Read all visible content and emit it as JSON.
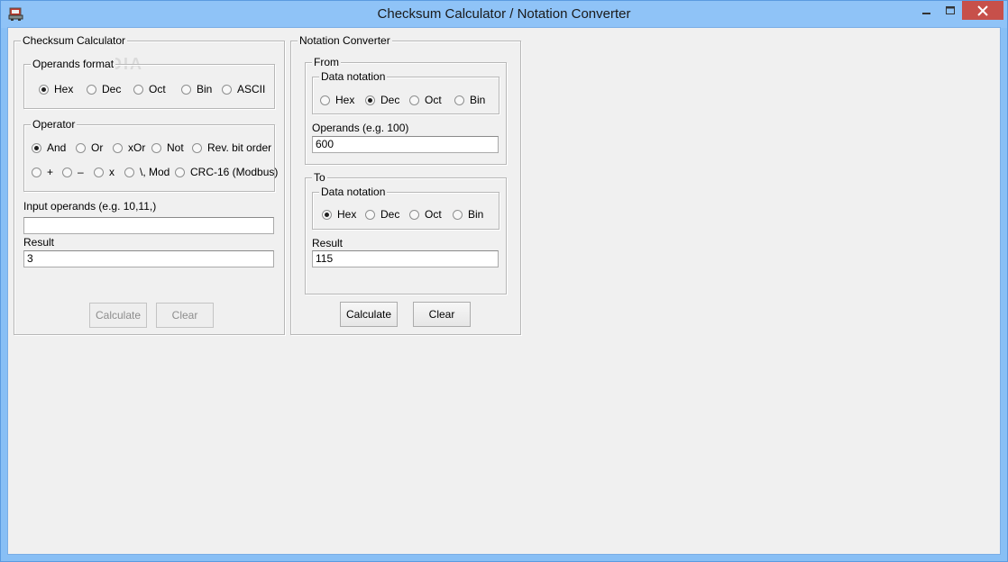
{
  "window": {
    "title": "Checksum Calculator / Notation Converter"
  },
  "checksum": {
    "group_title": "Checksum Calculator",
    "operands_format": {
      "title": "Operands format",
      "options": [
        {
          "label": "Hex",
          "checked": true
        },
        {
          "label": "Dec",
          "checked": false
        },
        {
          "label": "Oct",
          "checked": false
        },
        {
          "label": "Bin",
          "checked": false
        },
        {
          "label": "ASCII",
          "checked": false
        }
      ]
    },
    "operator": {
      "title": "Operator",
      "row1": [
        {
          "label": "And",
          "checked": true
        },
        {
          "label": "Or",
          "checked": false
        },
        {
          "label": "xOr",
          "checked": false
        },
        {
          "label": "Not",
          "checked": false
        },
        {
          "label": "Rev. bit order",
          "checked": false
        }
      ],
      "row2": [
        {
          "label": "+",
          "checked": false
        },
        {
          "label": "–",
          "checked": false
        },
        {
          "label": "x",
          "checked": false
        },
        {
          "label": "\\, Mod",
          "checked": false
        },
        {
          "label": "CRC-16 (Modbus)",
          "checked": false
        }
      ]
    },
    "input_label": "Input operands (e.g. 10,11,)",
    "input_value": "",
    "result_label": "Result",
    "result_value": "3",
    "calculate_label": "Calculate",
    "clear_label": "Clear"
  },
  "notation": {
    "group_title": "Notation Converter",
    "from": {
      "title": "From",
      "data_notation_title": "Data notation",
      "options": [
        {
          "label": "Hex",
          "checked": false
        },
        {
          "label": "Dec",
          "checked": true
        },
        {
          "label": "Oct",
          "checked": false
        },
        {
          "label": "Bin",
          "checked": false
        }
      ],
      "operands_label": "Operands (e.g. 100)",
      "operands_value": "600"
    },
    "to": {
      "title": "To",
      "data_notation_title": "Data notation",
      "options": [
        {
          "label": "Hex",
          "checked": true
        },
        {
          "label": "Dec",
          "checked": false
        },
        {
          "label": "Oct",
          "checked": false
        },
        {
          "label": "Bin",
          "checked": false
        }
      ],
      "result_label": "Result",
      "result_value": "115"
    },
    "calculate_label": "Calculate",
    "clear_label": "Clear"
  }
}
